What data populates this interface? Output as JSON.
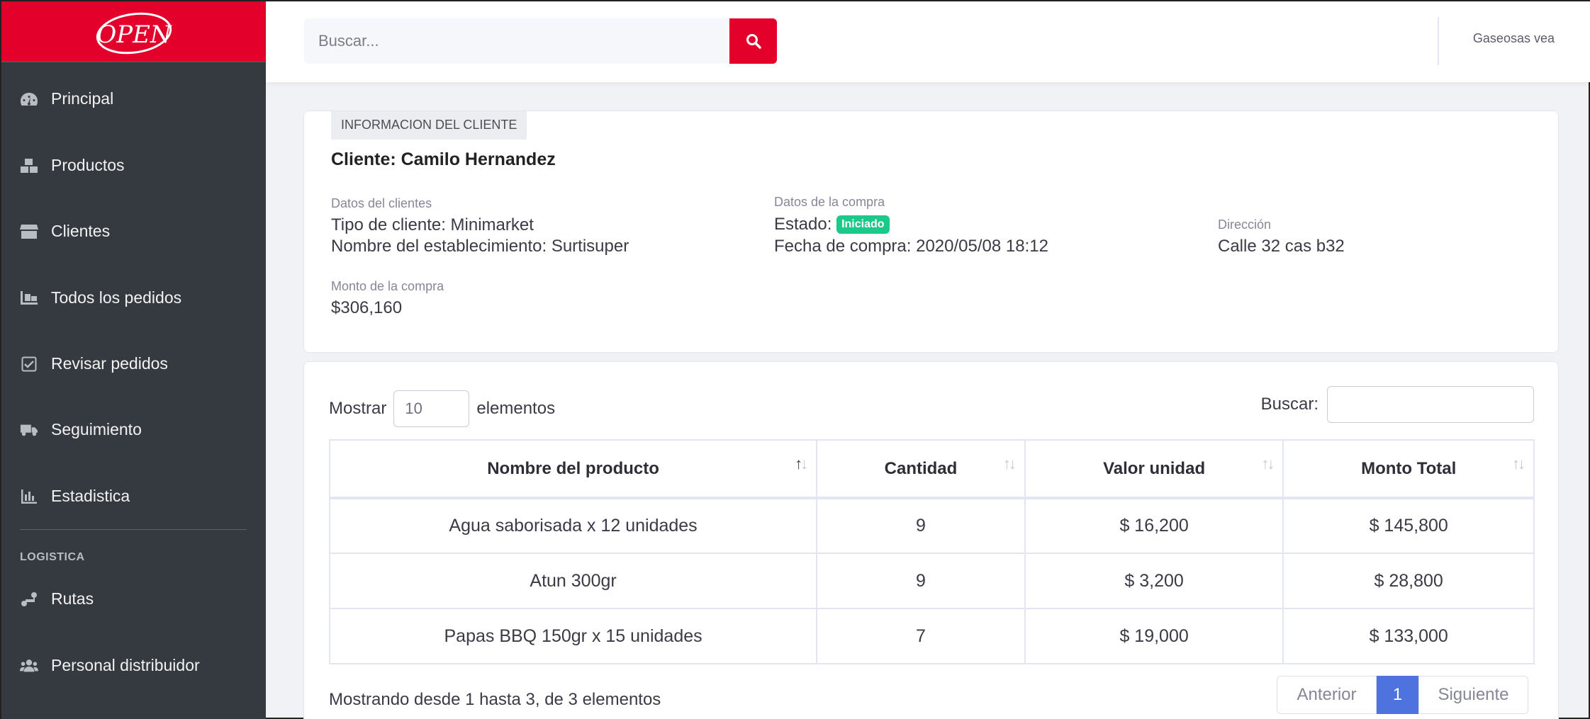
{
  "brand": {
    "logo_text": "OPEN",
    "accent": "#e3002b"
  },
  "sidebar": {
    "items": [
      {
        "label": "Principal",
        "icon": "tachometer-icon"
      },
      {
        "label": "Productos",
        "icon": "boxes-icon"
      },
      {
        "label": "Clientes",
        "icon": "store-icon"
      },
      {
        "label": "Todos los pedidos",
        "icon": "dolly-icon"
      },
      {
        "label": "Revisar pedidos",
        "icon": "check-square-icon"
      },
      {
        "label": "Seguimiento",
        "icon": "truck-icon"
      },
      {
        "label": "Estadistica",
        "icon": "chart-bar-icon"
      }
    ],
    "section_heading": "LOGISTICA",
    "logistics_items": [
      {
        "label": "Rutas",
        "icon": "route-icon"
      },
      {
        "label": "Personal distribuidor",
        "icon": "users-icon"
      }
    ]
  },
  "topbar": {
    "search_placeholder": "Buscar...",
    "user_name": "Gaseosas vea"
  },
  "client_info": {
    "tag": "INFORMACION DEL CLIENTE",
    "title": "Cliente: Camilo Hernandez",
    "datos_cliente_label": "Datos del clientes",
    "tipo_cliente": "Tipo de cliente: Minimarket",
    "establecimiento": "Nombre del establecimiento: Surtisuper",
    "datos_compra_label": "Datos de la compra",
    "estado_label": "Estado:",
    "estado_badge": "Iniciado",
    "fecha_compra": "Fecha de compra: 2020/05/08 18:12",
    "direccion_label": "Dirección",
    "direccion": "Calle 32 cas b32",
    "monto_label": "Monto de la compra",
    "monto": "$306,160"
  },
  "table_section": {
    "mostrar_label": "Mostrar",
    "page_length": "10",
    "elementos_label": "elementos",
    "buscar_label": "Buscar:",
    "columns": [
      "Nombre del producto",
      "Cantidad",
      "Valor unidad",
      "Monto Total"
    ],
    "rows": [
      [
        "Agua saborisada x 12 unidades",
        "9",
        "$ 16,200",
        "$ 145,800"
      ],
      [
        "Atun 300gr",
        "9",
        "$ 3,200",
        "$ 28,800"
      ],
      [
        "Papas BBQ 150gr x 15 unidades",
        "7",
        "$ 19,000",
        "$ 133,000"
      ]
    ],
    "info_text": "Mostrando desde 1 hasta 3, de 3 elementos",
    "pagination": {
      "prev": "Anterior",
      "current": "1",
      "next": "Siguiente"
    }
  }
}
